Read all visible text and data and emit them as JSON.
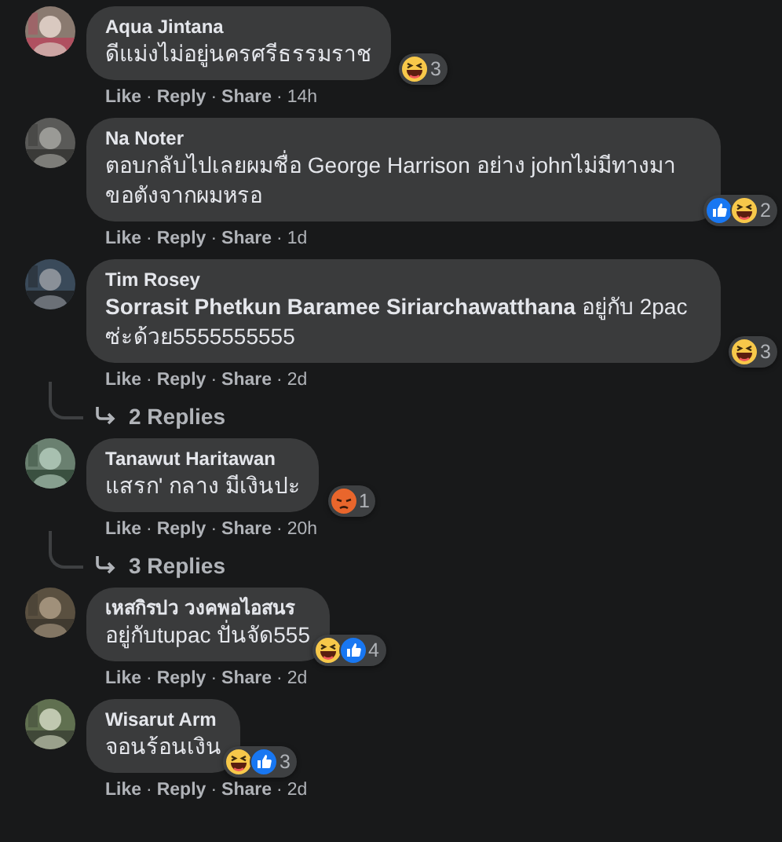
{
  "separator": "·",
  "comments": [
    {
      "author": "Aqua Jintana",
      "text": "ดีแม่งไม่อยู่นครศรีธรรมราช",
      "reactions": [
        {
          "kind": "haha"
        }
      ],
      "reaction_count": "3",
      "actions": [
        "Like",
        "Reply",
        "Share"
      ],
      "time": "14h"
    },
    {
      "author": "Na Noter",
      "text": "ตอบกลับไปเลยผมชื่อ George Harrison อย่าง johnไม่มีทางมาขอตังจากผมหรอ",
      "reactions": [
        {
          "kind": "like"
        },
        {
          "kind": "haha"
        }
      ],
      "reaction_count": "2",
      "actions": [
        "Like",
        "Reply",
        "Share"
      ],
      "time": "1d"
    },
    {
      "author": "Tim Rosey",
      "text": "**Sorrasit Phetkun Baramee Siriarchawatthana** อยู่กับ 2pac ซ่ะด้วย5555555555",
      "reactions": [
        {
          "kind": "haha"
        }
      ],
      "reaction_count": "3",
      "actions": [
        "Like",
        "Reply",
        "Share"
      ],
      "time": "2d",
      "replies_link": "2 Replies"
    },
    {
      "author": "Tanawut Haritawan",
      "text": "แสรก' กลาง มีเงินปะ",
      "reactions": [
        {
          "kind": "angry"
        }
      ],
      "reaction_count": "1",
      "actions": [
        "Like",
        "Reply",
        "Share"
      ],
      "time": "20h",
      "replies_link": "3 Replies"
    },
    {
      "author": "เหสกิรปว วงคพอไอสนร",
      "text": "อยู่กับtupac ปั่นจัด555",
      "reactions": [
        {
          "kind": "haha"
        },
        {
          "kind": "like"
        }
      ],
      "reaction_count": "4",
      "actions": [
        "Like",
        "Reply",
        "Share"
      ],
      "time": "2d"
    },
    {
      "author": "Wisarut Arm",
      "text": "จอนร้อนเงิน",
      "reactions": [
        {
          "kind": "haha"
        },
        {
          "kind": "like"
        }
      ],
      "reaction_count": "3",
      "actions": [
        "Like",
        "Reply",
        "Share"
      ],
      "time": "2d"
    }
  ]
}
